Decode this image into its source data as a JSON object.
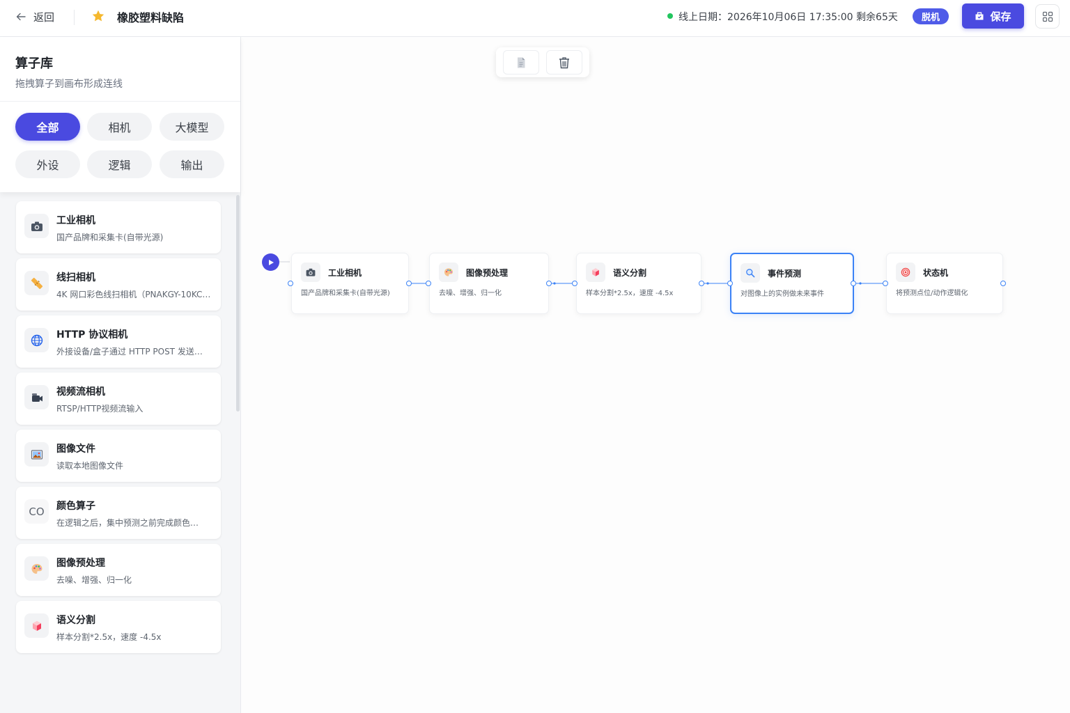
{
  "header": {
    "back_label": "返回",
    "project_title": "橡胶塑料缺陷",
    "online_text": "线上日期：2026年10月06日 17:35:00  剩余65天",
    "offline_badge": "脱机",
    "save_label": "保存",
    "status_color": "#22c55e"
  },
  "sidebar": {
    "title": "算子库",
    "subtitle": "拖拽算子到画布形成连线",
    "filters": [
      {
        "label": "全部",
        "active": true
      },
      {
        "label": "相机",
        "active": false
      },
      {
        "label": "大模型",
        "active": false
      },
      {
        "label": "外设",
        "active": false
      },
      {
        "label": "逻辑",
        "active": false
      },
      {
        "label": "输出",
        "active": false
      }
    ],
    "operators": [
      {
        "title": "工业相机",
        "desc": "国产品牌和采集卡(自带光源)",
        "icon": "camera-icon"
      },
      {
        "title": "线扫相机",
        "desc": "4K 网口彩色线扫相机（PNAKGY-10KC…",
        "icon": "ruler-icon"
      },
      {
        "title": "HTTP 协议相机",
        "desc": "外接设备/盒子通过 HTTP POST 发送…",
        "icon": "globe-icon"
      },
      {
        "title": "视频流相机",
        "desc": "RTSP/HTTP视频流输入",
        "icon": "video-camera-icon"
      },
      {
        "title": "图像文件",
        "desc": "读取本地图像文件",
        "icon": "image-file-icon"
      },
      {
        "title": "颜色算子",
        "desc": "在逻辑之后，集中预测之前完成颜色…",
        "icon": "color-text-icon",
        "icon_text": "CO"
      },
      {
        "title": "图像预处理",
        "desc": "去噪、增强、归一化",
        "icon": "palette-icon"
      },
      {
        "title": "语义分割",
        "desc": "样本分割*2.5x，速度 -4.5x",
        "icon": "cube-icon"
      }
    ]
  },
  "canvas": {
    "nodes": [
      {
        "title": "工业相机",
        "desc": "国产品牌和采集卡(自带光源)",
        "icon": "camera-icon",
        "selected": false
      },
      {
        "title": "图像预处理",
        "desc": "去噪、增强、归一化",
        "icon": "palette-icon",
        "selected": false
      },
      {
        "title": "语义分割",
        "desc": "样本分割*2.5x，速度 -4.5x",
        "icon": "cube-icon",
        "selected": false
      },
      {
        "title": "事件预测",
        "desc": "对图像上的实例做未来事件",
        "icon": "search-icon",
        "selected": true
      },
      {
        "title": "状态机",
        "desc": "将预测点位/动作逻辑化",
        "icon": "target-icon",
        "selected": false
      }
    ]
  },
  "colors": {
    "accent": "#4a4ae0",
    "selected_border": "#3b82f6"
  }
}
